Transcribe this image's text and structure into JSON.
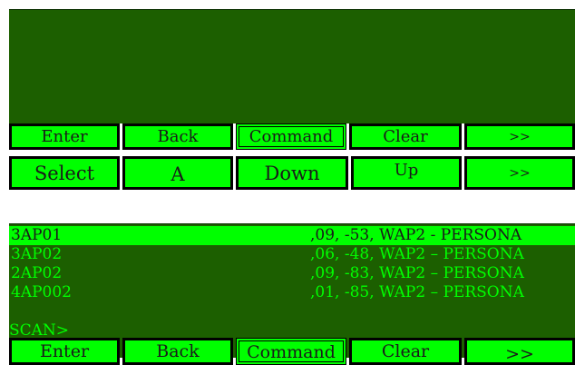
{
  "colors": {
    "screen_background": "#1c5f00",
    "button_fill": "#00ff00",
    "text_green": "#00ff00",
    "button_border": "#000000"
  },
  "top_display": {
    "text": ""
  },
  "button_rows": [
    {
      "buttons": [
        "Enter",
        "Back",
        "Command",
        "Clear",
        ">>"
      ]
    },
    {
      "buttons": [
        "Select",
        "A",
        "Down",
        "Up",
        ">>"
      ]
    },
    {
      "buttons": [
        "Enter",
        "Back",
        "Command",
        "Clear",
        ">>"
      ]
    }
  ],
  "network_list": {
    "rows": [
      {
        "id": "3AP01",
        "info": ",09, -53, WAP2 -  PERSONA",
        "selected": true
      },
      {
        "id": "3AP02",
        "info": ",06, -48, WAP2 – PERSONA",
        "selected": false
      },
      {
        "id": "2AP02",
        "info": ",09, -83, WAP2 – PERSONA",
        "selected": false
      },
      {
        "id": "4AP002",
        "info": ",01, -85, WAP2 – PERSONA",
        "selected": false
      }
    ],
    "prompt": "SCAN>"
  }
}
